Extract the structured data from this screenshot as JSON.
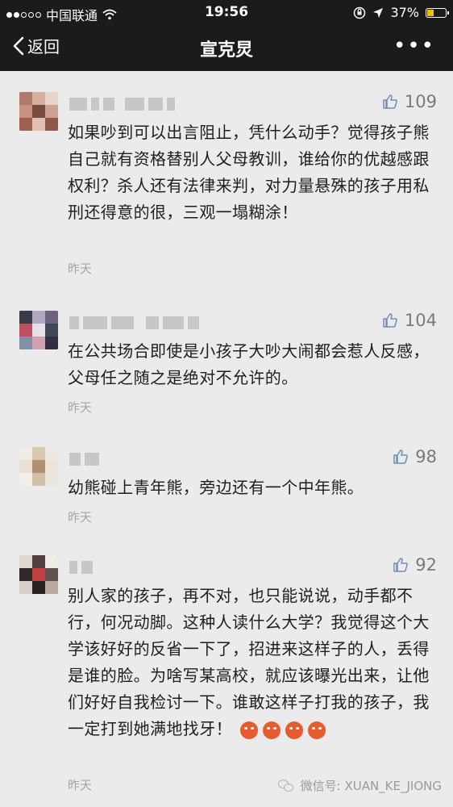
{
  "status_bar": {
    "carrier": "中国联通",
    "time": "19:56",
    "battery": "37%",
    "battery_level": 0.37
  },
  "nav": {
    "back_label": "返回",
    "title": "宣克炅",
    "more_label": "•••"
  },
  "comments": [
    {
      "likes": "109",
      "text": "如果吵到可以出言阻止，凭什么动手？觉得孩子熊自己就有资格替别人父母教训，谁给你的优越感跟权利？杀人还有法律来判，对力量悬殊的孩子用私刑还得意的很，三观一塌糊涂！",
      "time": "昨天"
    },
    {
      "likes": "104",
      "text": "在公共场合即使是小孩子大吵大闹都会惹人反感，父母任之随之是绝对不允许的。",
      "time": "昨天"
    },
    {
      "likes": "98",
      "text": "幼熊碰上青年熊，旁边还有一个中年熊。",
      "time": "昨天"
    },
    {
      "likes": "92",
      "text": "别人家的孩子，再不对，也只能说说，动手都不行，何况动脚。这种人读什么大学？我觉得这个大学该好好的反省一下了，招进来这样子的人，丢得是谁的脸。为啥写某高校，就应该曝光出来，让他们好好自我检讨一下。谁敢这样子打我的孩子，我一定打到她满地找牙！",
      "time": "昨天"
    }
  ],
  "watermark": {
    "text": "微信号: XUAN_KE_JIONG"
  }
}
